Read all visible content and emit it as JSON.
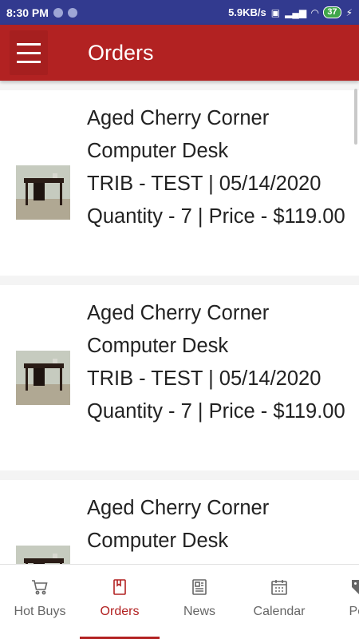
{
  "status_bar": {
    "time": "8:30 PM",
    "network_speed": "5.9KB/s",
    "battery_level": "37"
  },
  "app_bar": {
    "title": "Orders",
    "menu_icon": "hamburger-menu-icon"
  },
  "orders": [
    {
      "name": "Aged Cherry Corner Computer Desk",
      "meta": "TRIB - TEST | 05/14/2020",
      "quantity_price": "Quantity - 7 |  Price - $119.00"
    },
    {
      "name": "Aged Cherry Corner Computer Desk",
      "meta": "TRIB - TEST | 05/14/2020",
      "quantity_price": "Quantity - 7 |  Price - $119.00"
    },
    {
      "name": "Aged Cherry Corner Computer Desk",
      "meta": "",
      "quantity_price": ""
    }
  ],
  "bottom_nav": {
    "items": [
      {
        "label": "Hot Buys",
        "icon": "cart-icon",
        "active": false
      },
      {
        "label": "Orders",
        "icon": "book-icon",
        "active": true
      },
      {
        "label": "News",
        "icon": "newspaper-icon",
        "active": false
      },
      {
        "label": "Calendar",
        "icon": "calendar-icon",
        "active": false
      },
      {
        "label": "Per",
        "icon": "tag-icon",
        "active": false
      }
    ]
  },
  "colors": {
    "status_bar": "#323a8f",
    "app_bar": "#b22222",
    "active_nav": "#b22222"
  }
}
